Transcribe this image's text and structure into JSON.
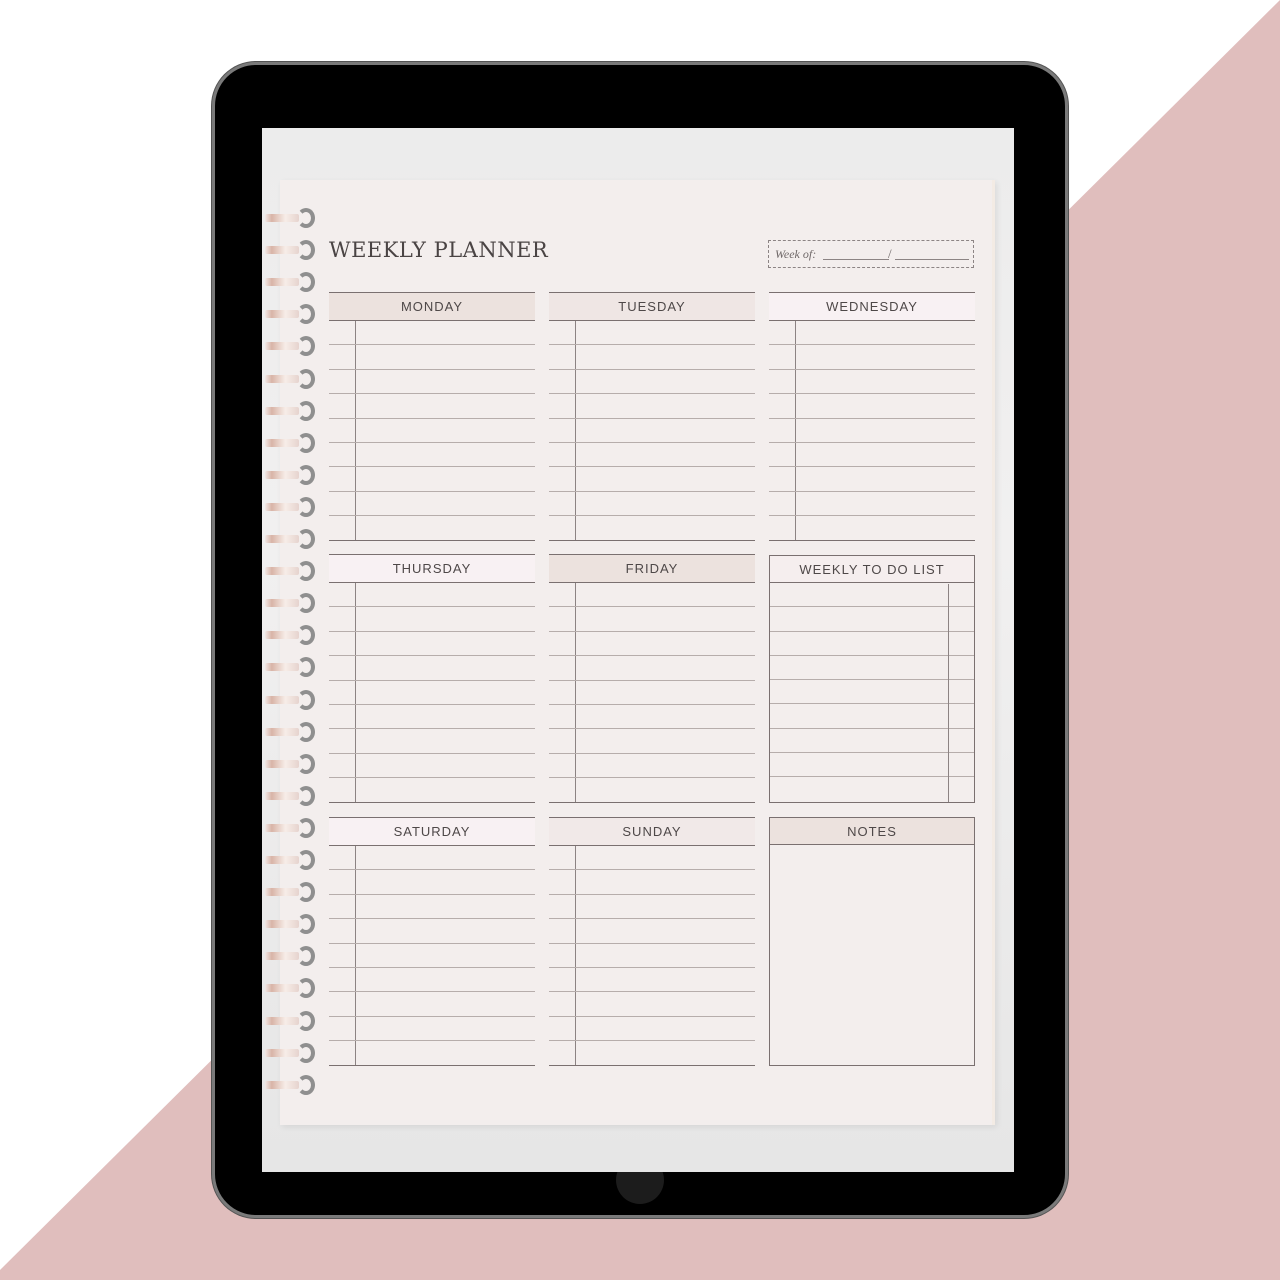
{
  "background": {
    "accent_color": "#e0bebd"
  },
  "planner": {
    "title": "WEEKLY PLANNER",
    "week_of": {
      "label": "Week of:",
      "separator": "/",
      "start_date": "",
      "end_date": ""
    },
    "days": [
      {
        "label": "MONDAY",
        "rows": 9
      },
      {
        "label": "TUESDAY",
        "rows": 9
      },
      {
        "label": "WEDNESDAY",
        "rows": 9
      },
      {
        "label": "THURSDAY",
        "rows": 9
      },
      {
        "label": "FRIDAY",
        "rows": 9
      },
      {
        "label": "SATURDAY",
        "rows": 9
      },
      {
        "label": "SUNDAY",
        "rows": 9
      }
    ],
    "todo": {
      "label": "WEEKLY TO DO LIST",
      "rows": 9
    },
    "notes": {
      "label": "NOTES"
    }
  },
  "device": {
    "spiral_ring_count": 28
  }
}
